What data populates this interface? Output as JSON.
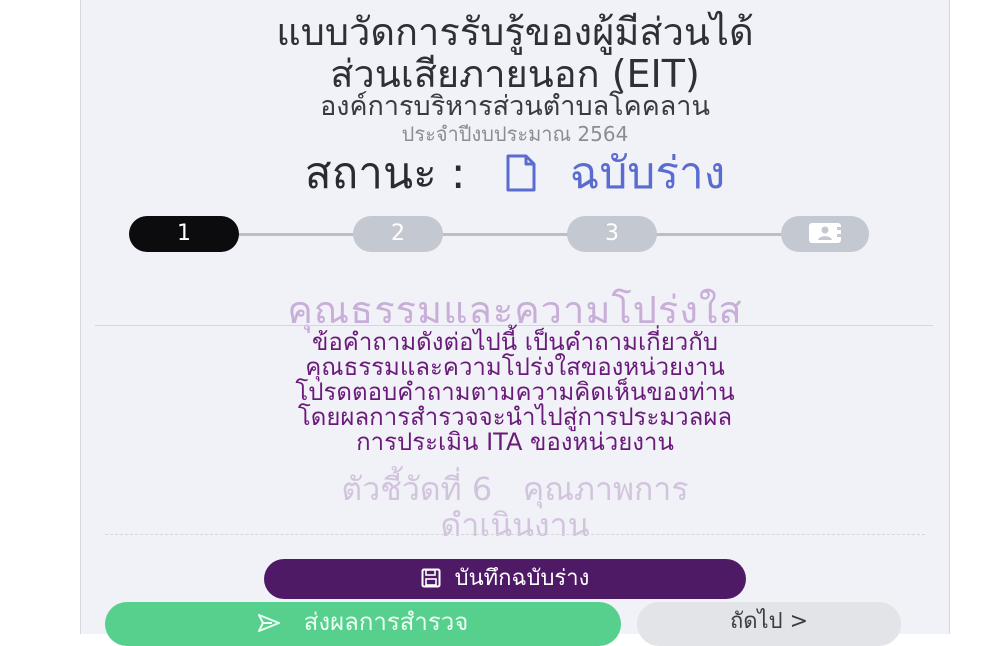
{
  "header": {
    "title_line1": "แบบวัดการรับรู้ของผู้มีส่วนได้",
    "title_line2": "ส่วนเสียภายนอก (EIT)",
    "organization": "องค์การบริหารส่วนตำบลโคคลาน",
    "fiscal_year": "ประจำปีงบประมาณ 2564"
  },
  "status": {
    "label": "สถานะ :",
    "value": "ฉบับร่าง",
    "icon": "document-icon"
  },
  "stepper": {
    "steps": [
      "1",
      "2",
      "3",
      ""
    ],
    "current": 1,
    "last_icon": "contact-card-icon"
  },
  "section": {
    "title": "คุณธรรมและความโปร่งใส",
    "description": [
      "ข้อคำถามดังต่อไปนี้ เป็นคำถามเกี่ยวกับ",
      "คุณธรรมและความโปร่งใสของหน่วยงาน",
      "โปรดตอบคำถามตามความคิดเห็นของท่าน",
      "โดยผลการสำรวจจะนำไปสู่การประมวลผล",
      "การประเมิน ITA ของหน่วยงาน"
    ]
  },
  "indicator": {
    "line1": "ตัวชี้วัดที่ 6   คุณภาพการ",
    "line2": "ดำเนินงาน"
  },
  "actions": {
    "save_draft": "บันทึกฉบับร่าง",
    "save_icon": "floppy-disk-icon",
    "submit": "ส่งผลการสำรวจ",
    "submit_icon": "send-icon",
    "next": "ถัดไป >"
  },
  "colors": {
    "background": "#f1f2f7",
    "draft_blue": "#5a6cd0",
    "section_title": "#c8aed8",
    "description_purple": "#6a1b7a",
    "save_button": "#4e1a66",
    "submit_button": "#58d08d",
    "next_button": "#e3e4e8",
    "step_active": "#0c0c0e",
    "step_inactive": "#c4c8d1"
  }
}
